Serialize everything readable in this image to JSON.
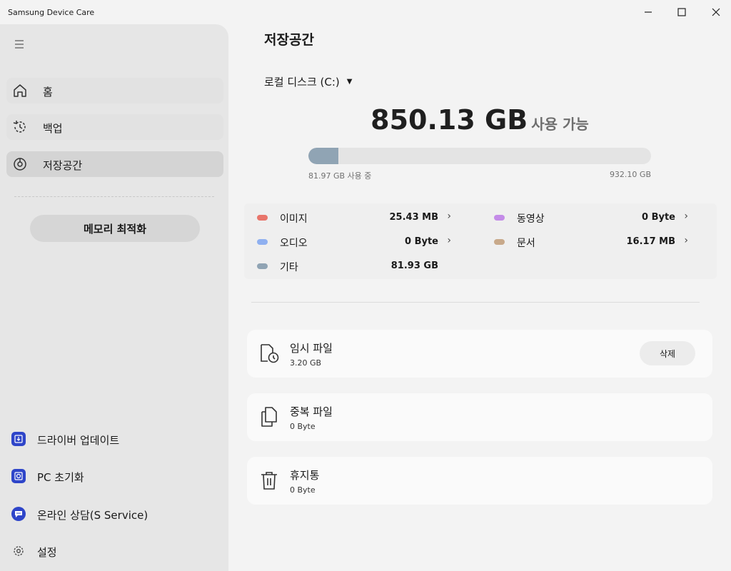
{
  "window": {
    "title": "Samsung Device Care"
  },
  "sidebar": {
    "nav": [
      {
        "label": "홈",
        "icon": "home-icon"
      },
      {
        "label": "백업",
        "icon": "backup-history-icon"
      },
      {
        "label": "저장공간",
        "icon": "storage-icon"
      }
    ],
    "memory_button": "메모리 최적화",
    "bottom": [
      {
        "label": "드라이버 업데이트",
        "icon": "driver-update-icon"
      },
      {
        "label": "PC 초기화",
        "icon": "pc-reset-icon"
      },
      {
        "label": "온라인 상담(S Service)",
        "icon": "chat-icon"
      },
      {
        "label": "설정",
        "icon": "gear-icon"
      }
    ]
  },
  "main": {
    "title": "저장공간",
    "drive": "로컬 디스크 (C:)",
    "available_value": "850.13 GB",
    "available_label": "사용 가능",
    "used_label": "81.97 GB 사용 중",
    "total_label": "932.10 GB",
    "used_fraction": 0.088,
    "categories": [
      {
        "name": "이미지",
        "value": "25.43 MB",
        "color": "#e8756b",
        "chevron": true
      },
      {
        "name": "동영상",
        "value": "0 Byte",
        "color": "#c48be8",
        "chevron": true
      },
      {
        "name": "오디오",
        "value": "0 Byte",
        "color": "#8fb0f0",
        "chevron": true
      },
      {
        "name": "문서",
        "value": "16.17 MB",
        "color": "#c8a98a",
        "chevron": true
      },
      {
        "name": "기타",
        "value": "81.93 GB",
        "color": "#90a4b4",
        "chevron": false
      }
    ],
    "cards": [
      {
        "title": "임시 파일",
        "size": "3.20 GB",
        "icon": "temp-file-clock-icon",
        "button": "삭제"
      },
      {
        "title": "중복 파일",
        "size": "0 Byte",
        "icon": "duplicate-files-icon"
      },
      {
        "title": "휴지통",
        "size": "0 Byte",
        "icon": "trash-icon"
      }
    ]
  }
}
